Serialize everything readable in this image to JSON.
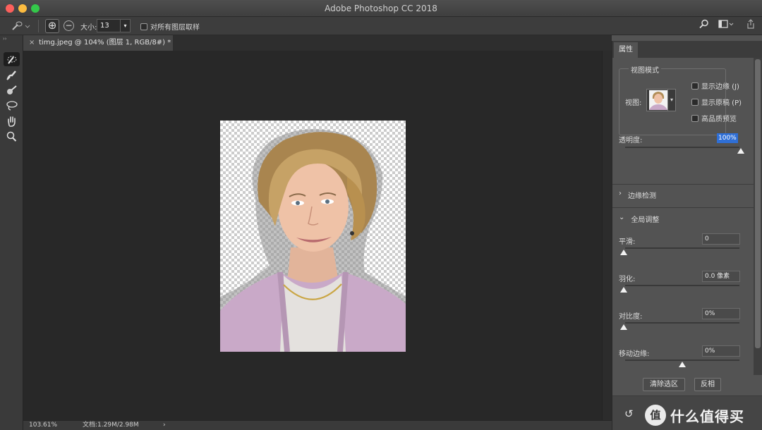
{
  "window": {
    "title": "Adobe Photoshop CC 2018"
  },
  "options_bar": {
    "tool_preset_icon": "quick-selection-brush-icon",
    "size_label": "大小:",
    "size_value": "13",
    "sample_all_layers_label": "对所有图层取样",
    "add_mode_icon": "plus-circle-icon",
    "subtract_mode_icon": "minus-circle-icon",
    "search_icon": "search-icon",
    "workspace_icon": "workspace-icon",
    "share_icon": "share-icon"
  },
  "toolbar": {
    "tools": [
      {
        "name": "quick-selection-tool",
        "active": true
      },
      {
        "name": "refine-edge-brush-tool",
        "active": false
      },
      {
        "name": "brush-tool",
        "active": false
      },
      {
        "name": "lasso-tool",
        "active": false
      },
      {
        "name": "hand-tool",
        "active": false
      },
      {
        "name": "zoom-tool",
        "active": false
      }
    ]
  },
  "document": {
    "tab_title": "timg.jpeg @ 104% (图层 1, RGB/8#) *",
    "close_symbol": "×"
  },
  "status": {
    "zoom": "103.61%",
    "doc_info": "文档:1.29M/2.98M",
    "arrow": "›"
  },
  "properties": {
    "tab": "属性",
    "view_mode_title": "视图模式",
    "view_label": "视图:",
    "show_edge": "显示边缘 (J)",
    "show_original": "显示原稿 (P)",
    "hq_preview": "高品质预览",
    "opacity_label": "透明度:",
    "opacity_value": "100%",
    "opacity_level": 1.0,
    "edge_detection": "边缘检测",
    "global_refinements": "全局调整",
    "smooth_label": "平滑:",
    "smooth_value": "0",
    "smooth_level": 0.0,
    "feather_label": "羽化:",
    "feather_value": "0.0 像素",
    "feather_level": 0.0,
    "contrast_label": "对比度:",
    "contrast_value": "0%",
    "contrast_level": 0.0,
    "shift_edge_label": "移动边缘:",
    "shift_edge_value": "0%",
    "shift_edge_level": 0.5,
    "clear_selection": "清除选区",
    "invert": "反相"
  },
  "watermark": {
    "badge": "值",
    "text": "什么值得买"
  }
}
